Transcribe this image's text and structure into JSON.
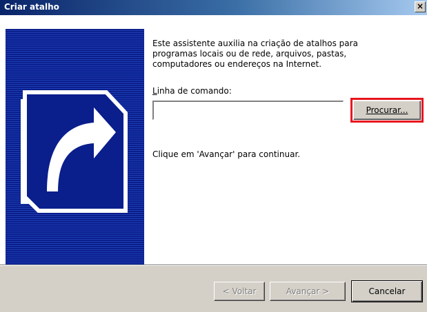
{
  "window": {
    "title": "Criar atalho",
    "close_glyph": "×"
  },
  "banner": {
    "icon": "shortcut-arrow-icon"
  },
  "main": {
    "description": "Este assistente auxilia na criação de atalhos para\nprogramas locais ou de rede, arquivos, pastas,\ncomputadores ou endereços na Internet.",
    "command_label": "Linha de comando:",
    "command_value": "",
    "browse_label": "Procurar...",
    "continue_hint": "Clique em 'Avançar' para continuar."
  },
  "footer": {
    "back_label": "< Voltar",
    "next_label": "Avançar >",
    "cancel_label": "Cancelar"
  },
  "colors": {
    "titlebar": "#0a246a",
    "banner": "#0a1e8c",
    "highlight": "#e8141e"
  }
}
